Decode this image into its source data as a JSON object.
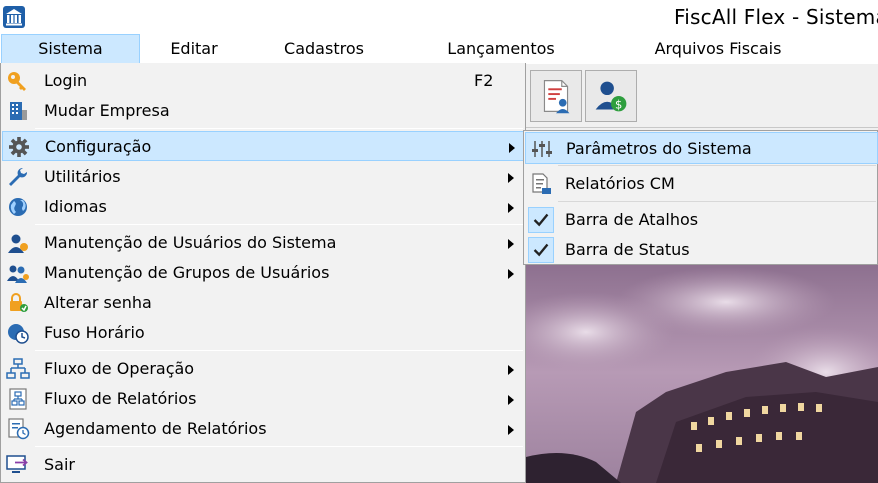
{
  "window": {
    "title": "FiscAll Flex - Sistema"
  },
  "menubar": {
    "items": [
      {
        "label": "Sistema",
        "active": true
      },
      {
        "label": "Editar"
      },
      {
        "label": "Cadastros"
      },
      {
        "label": "Lançamentos"
      },
      {
        "label": "Arquivos Fiscais"
      }
    ]
  },
  "menu": {
    "items": [
      {
        "label": "Login",
        "shortcut": "F2",
        "icon": "key-icon"
      },
      {
        "label": "Mudar Empresa",
        "icon": "building-icon"
      },
      {
        "label": "Configuração",
        "icon": "gear-icon",
        "submenu": true,
        "highlighted": true
      },
      {
        "label": "Utilitários",
        "icon": "wrench-icon",
        "submenu": true
      },
      {
        "label": "Idiomas",
        "icon": "globe-icon",
        "submenu": true
      },
      {
        "label": "Manutenção de Usuários do Sistema",
        "icon": "user-icon",
        "submenu": true
      },
      {
        "label": "Manutenção de Grupos de Usuários",
        "icon": "users-group-icon",
        "submenu": true
      },
      {
        "label": "Alterar senha",
        "icon": "lock-icon"
      },
      {
        "label": "Fuso Horário",
        "icon": "clock-globe-icon"
      },
      {
        "label": "Fluxo de Operação",
        "icon": "flowchart-icon",
        "submenu": true
      },
      {
        "label": "Fluxo de Relatórios",
        "icon": "report-flow-icon",
        "submenu": true
      },
      {
        "label": "Agendamento de Relatórios",
        "icon": "schedule-report-icon",
        "submenu": true
      },
      {
        "label": "Sair",
        "icon": "exit-icon"
      }
    ]
  },
  "submenu": {
    "items": [
      {
        "label": "Parâmetros do Sistema",
        "icon": "sliders-icon",
        "highlighted": true
      },
      {
        "label": "Relatórios CM",
        "icon": "report-icon"
      },
      {
        "label": "Barra de Atalhos",
        "icon": "checkmark-icon",
        "checked": true
      },
      {
        "label": "Barra de Status",
        "icon": "checkmark-icon",
        "checked": true
      }
    ]
  },
  "toolbar": {
    "buttons": [
      {
        "icon": "document-user-icon"
      },
      {
        "icon": "user-money-icon"
      }
    ]
  },
  "colors": {
    "highlight": "#cce8ff",
    "highlight_border": "#99d1ff",
    "menu_bg": "#f2f2f2",
    "icon_blue": "#2b6cb3",
    "icon_orange": "#f0a020"
  }
}
